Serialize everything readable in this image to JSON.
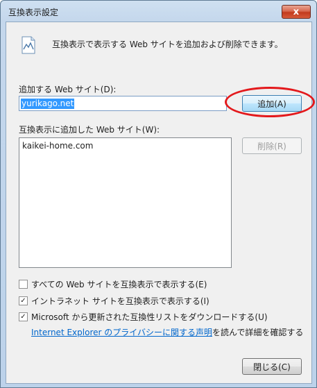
{
  "window": {
    "title": "互換表示設定",
    "close_glyph": "x"
  },
  "info": {
    "icon": "document-icon",
    "text": "互換表示で表示する Web サイトを追加および削除できます。"
  },
  "add_site": {
    "label": "追加する Web サイト(D):",
    "input_value": "yurikago.net",
    "add_button": "追加(A)"
  },
  "list": {
    "label": "互換表示に追加した Web サイト(W):",
    "items": [
      "kaikei-home.com"
    ],
    "remove_button": "削除(R)"
  },
  "options": [
    {
      "label": "すべての Web サイトを互換表示で表示する(E)",
      "checked": false
    },
    {
      "label": "イントラネット サイトを互換表示で表示する(I)",
      "checked": true
    },
    {
      "label": "Microsoft から更新された互換性リストをダウンロードする(U)",
      "checked": true
    }
  ],
  "privacy": {
    "link_text": "Internet Explorer のプライバシーに関する声明",
    "suffix": "を読んで詳細を確認する"
  },
  "footer": {
    "close_button": "閉じる(C)"
  },
  "colors": {
    "annotation_circle": "#e3191c",
    "selection": "#3399ff",
    "link": "#0066cc"
  }
}
